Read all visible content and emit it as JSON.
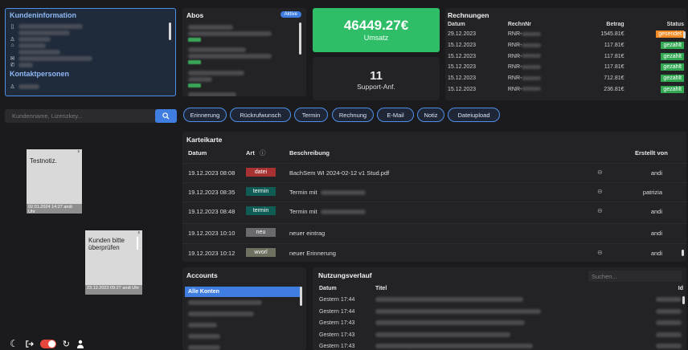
{
  "kunden": {
    "title": "Kundeninformation",
    "kontakt_title": "Kontaktpersonen",
    "rows": [
      {
        "icon": "building-icon"
      },
      {
        "icon": "none"
      },
      {
        "icon": "person-icon"
      },
      {
        "icon": "home-icon"
      },
      {
        "icon": "none"
      },
      {
        "icon": "mail-icon"
      },
      {
        "icon": "phone-icon"
      }
    ]
  },
  "abos": {
    "title": "Abos",
    "badge": "Aktive"
  },
  "umsatz": {
    "value": "46449.27€",
    "label": "Umsatz"
  },
  "support": {
    "value": "11",
    "label": "Support-Anf."
  },
  "rechnungen": {
    "title": "Rechnungen",
    "columns": [
      "Datum",
      "RechnNr",
      "Betrag",
      "Status"
    ],
    "rows": [
      {
        "datum": "29.12.2023",
        "nr": "RNR-",
        "betrag": "1545.81€",
        "status": "gesendet",
        "status_color": "#f08a24"
      },
      {
        "datum": "15.12.2023",
        "nr": "RNR-",
        "betrag": "117.81€",
        "status": "gezahlt",
        "status_color": "#32a852"
      },
      {
        "datum": "15.12.2023",
        "nr": "RNR-",
        "betrag": "117.81€",
        "status": "gezahlt",
        "status_color": "#32a852"
      },
      {
        "datum": "15.12.2023",
        "nr": "RNR-",
        "betrag": "117.81€",
        "status": "gezahlt",
        "status_color": "#32a852"
      },
      {
        "datum": "15.12.2023",
        "nr": "RNR-",
        "betrag": "712.81€",
        "status": "gezahlt",
        "status_color": "#32a852"
      },
      {
        "datum": "15.12.2023",
        "nr": "RNR-",
        "betrag": "236.81€",
        "status": "gezahlt",
        "status_color": "#32a852"
      }
    ]
  },
  "search": {
    "placeholder": "Kundenname, Lizenzkey..."
  },
  "actions": [
    "Erinnerung",
    "Rückrufwunsch",
    "Termin",
    "Rechnung",
    "E-Mail",
    "Notiz",
    "Dateiupload"
  ],
  "notes": [
    {
      "text": "Testnotiz.",
      "footer": "02.01.2024 14:27  andi Uhr"
    },
    {
      "text": "Kunden bitte überprüfen",
      "footer": "23.12.2023 09:27  andi Uhr"
    }
  ],
  "kartei": {
    "title": "Karteikarte",
    "columns": [
      "Datum",
      "Art",
      "Beschreibung",
      "Erstellt von"
    ],
    "rows": [
      {
        "datum": "19.12.2023 08:08",
        "art": "datei",
        "desc": "BachSem WI 2024-02-12 v1 Stud.pdf",
        "link": true,
        "by": "andi"
      },
      {
        "datum": "19.12.2023 08:35",
        "art": "termin",
        "desc": "Termin mit",
        "link": true,
        "by": "patrizia"
      },
      {
        "datum": "19.12.2023 08:48",
        "art": "termin",
        "desc": "Termin mit",
        "link": true,
        "by": "andi"
      },
      {
        "datum": "19.12.2023 10:10",
        "art": "neu",
        "desc": "neuer eintrag",
        "link": false,
        "by": "andi"
      },
      {
        "datum": "19.12.2023 10:12",
        "art": "wvorl",
        "desc": "neuer Erinnerung",
        "link": true,
        "by": "andi"
      }
    ]
  },
  "accounts": {
    "title": "Accounts",
    "items": [
      "Alle Konten"
    ]
  },
  "nutzung": {
    "title": "Nutzungsverlauf",
    "search_placeholder": "Suchen...",
    "columns": [
      "Datum",
      "Titel",
      "Id"
    ],
    "rows": [
      {
        "datum": "Gestern 17:44"
      },
      {
        "datum": "Gestern 17:44"
      },
      {
        "datum": "Gestern 17:43"
      },
      {
        "datum": "Gestern 17:43"
      },
      {
        "datum": "Gestern 17:43"
      }
    ]
  },
  "colors": {
    "accent": "#3f7ee0",
    "umsatz_bg": "#2fbd68",
    "toggle": "#e8453c"
  }
}
